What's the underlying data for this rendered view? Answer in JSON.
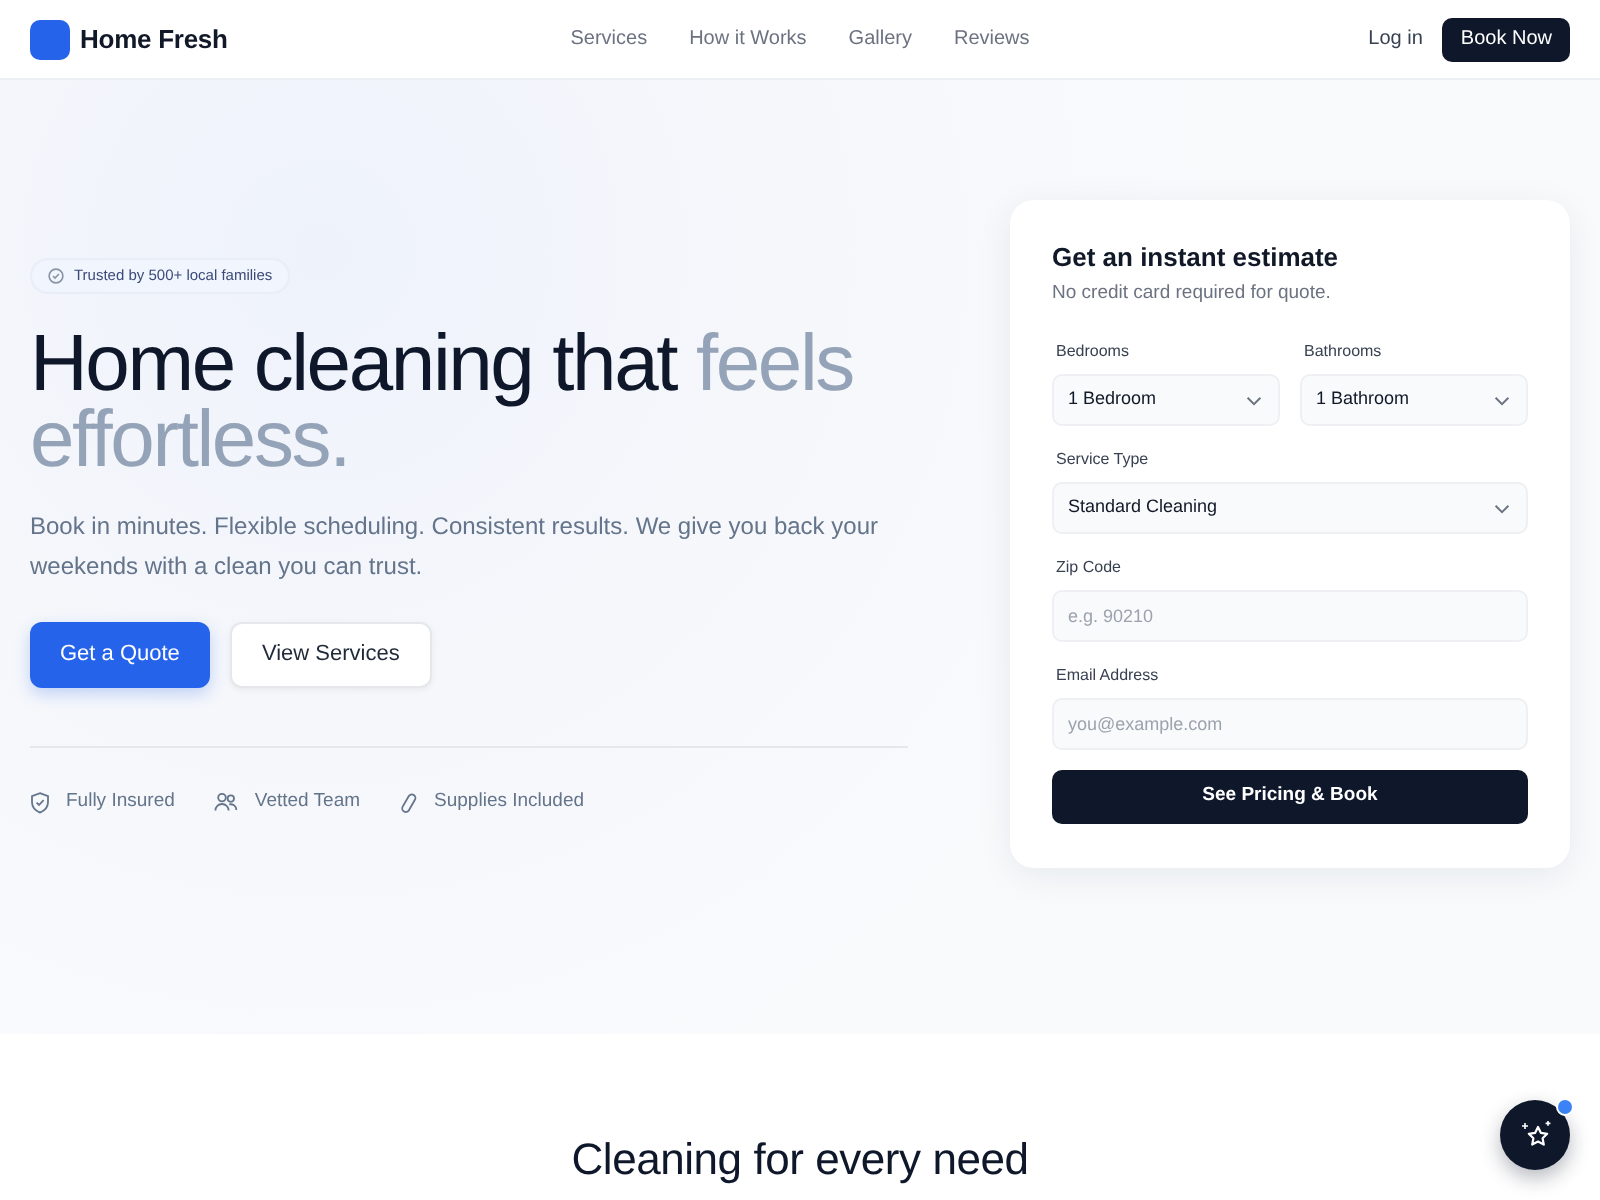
{
  "navbar": {
    "brand": "Home Fresh",
    "links": [
      "Services",
      "How it Works",
      "Gallery",
      "Reviews"
    ],
    "login": "Log in",
    "cta": "Book Now"
  },
  "hero": {
    "badge": "Trusted by 500+ local families",
    "heading": "Home cleaning that",
    "heading_accent": "feels effortless.",
    "text": "Book in minutes. Flexible scheduling. Consistent results. We give you back your weekends with a clean you can trust.",
    "buttons": [
      {
        "label": "Get a Quote",
        "kind": "primary"
      },
      {
        "label": "View Services",
        "kind": "secondary"
      }
    ],
    "features": [
      "Fully Insured",
      "Vetted Team",
      "Supplies Included"
    ]
  },
  "estimate_form": {
    "title": "Get an instant estimate",
    "subtitle": "No credit card required for quote.",
    "rows": [
      [
        {
          "label": "Bedrooms",
          "kind": "select",
          "value": "1 Bedroom"
        },
        {
          "label": "Bathrooms",
          "kind": "select",
          "value": "1 Bathroom"
        }
      ],
      [
        {
          "label": "Service Type",
          "kind": "select",
          "value": "Standard Cleaning"
        }
      ],
      [
        {
          "label": "Zip Code",
          "kind": "input",
          "placeholder": "e.g. 90210"
        }
      ],
      [
        {
          "label": "Email Address",
          "kind": "input",
          "placeholder": "you@example.com"
        }
      ]
    ],
    "submit": "See Pricing & Book"
  },
  "section": {
    "heading": "Cleaning for every need"
  },
  "assistant_button": {
    "notification": true
  }
}
